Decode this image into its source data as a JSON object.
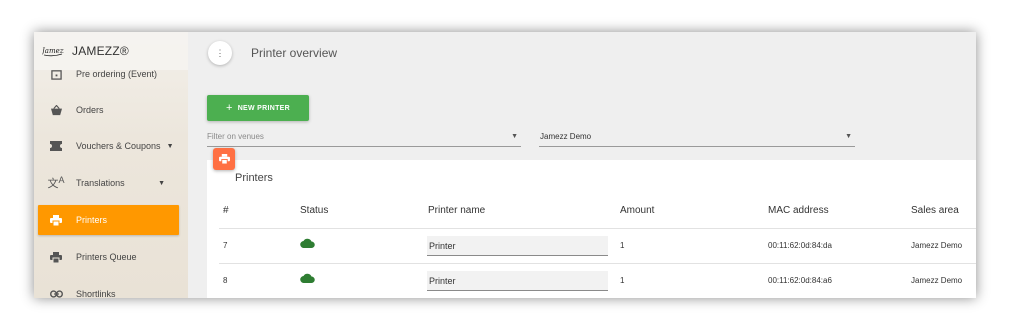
{
  "brand": {
    "logo_text": "Jamezz",
    "name": "JAMEZZ®"
  },
  "sidebar": {
    "items": [
      {
        "label": "Pre ordering (Event)",
        "icon": "calendar-icon"
      },
      {
        "label": "Orders",
        "icon": "basket-icon"
      },
      {
        "label": "Vouchers & Coupons",
        "icon": "ticket-icon",
        "expandable": true
      },
      {
        "label": "Translations",
        "icon": "translate-icon",
        "expandable": true
      },
      {
        "label": "Printers",
        "icon": "printer-icon",
        "active": true
      },
      {
        "label": "Printers Queue",
        "icon": "printer-icon"
      },
      {
        "label": "Shortlinks",
        "icon": "link-icon"
      }
    ]
  },
  "header": {
    "title": "Printer overview",
    "menu_icon": "more-vert-icon"
  },
  "toolbar": {
    "new_printer_label": "NEW PRINTER"
  },
  "filters": {
    "venues_placeholder": "Filter on venues",
    "company_value": "Jamezz Demo"
  },
  "colors": {
    "active": "#ff9800",
    "primary_button": "#4caf50",
    "badge": "#ff7043",
    "status_online": "#2e7d32"
  },
  "card": {
    "title": "Printers",
    "columns": [
      "#",
      "Status",
      "Printer name",
      "Amount",
      "MAC address",
      "Sales area"
    ],
    "rows": [
      {
        "id": "7",
        "status": "online",
        "name": "Printer",
        "amount": "1",
        "mac": "00:11:62:0d:84:da",
        "sales_area": "Jamezz Demo"
      },
      {
        "id": "8",
        "status": "online",
        "name": "Printer",
        "amount": "1",
        "mac": "00:11:62:0d:84:a6",
        "sales_area": "Jamezz Demo"
      }
    ]
  }
}
